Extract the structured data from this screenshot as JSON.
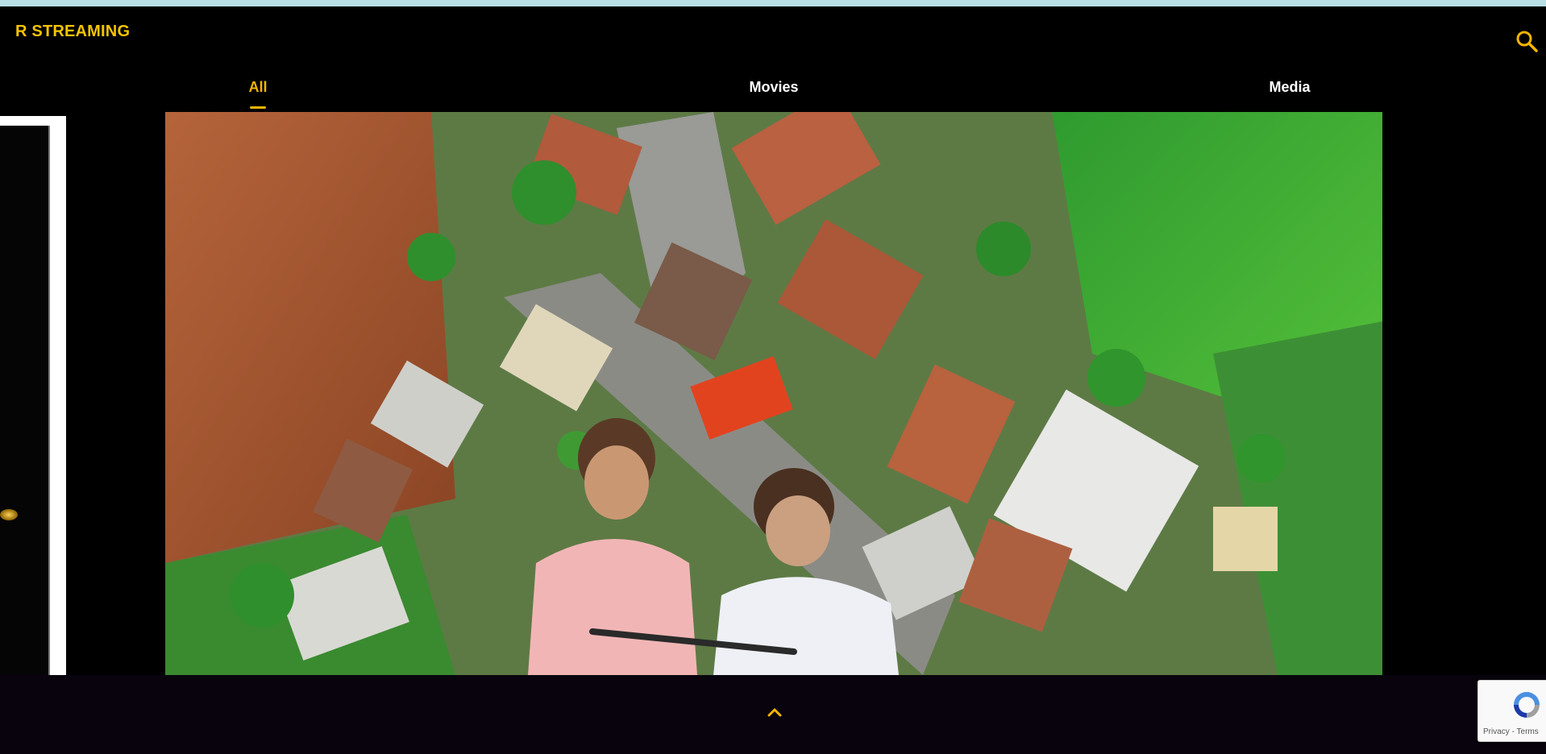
{
  "header": {
    "brand": "R STREAMING",
    "search_icon": "search-icon"
  },
  "tabs": [
    {
      "label": "All",
      "active": true
    },
    {
      "label": "Movies",
      "active": false
    },
    {
      "label": "Media",
      "active": false
    }
  ],
  "hero": {
    "image": "aerial-village-with-two-children-photo"
  },
  "footer": {
    "scroll_top_icon": "chevron-up-icon"
  },
  "recaptcha": {
    "privacy": "Privacy",
    "separator": " - ",
    "terms": "Terms"
  },
  "colors": {
    "brand": "#f5c400",
    "accent": "#f5b400",
    "top_strip": "#b8dfe3",
    "background": "#000000"
  }
}
